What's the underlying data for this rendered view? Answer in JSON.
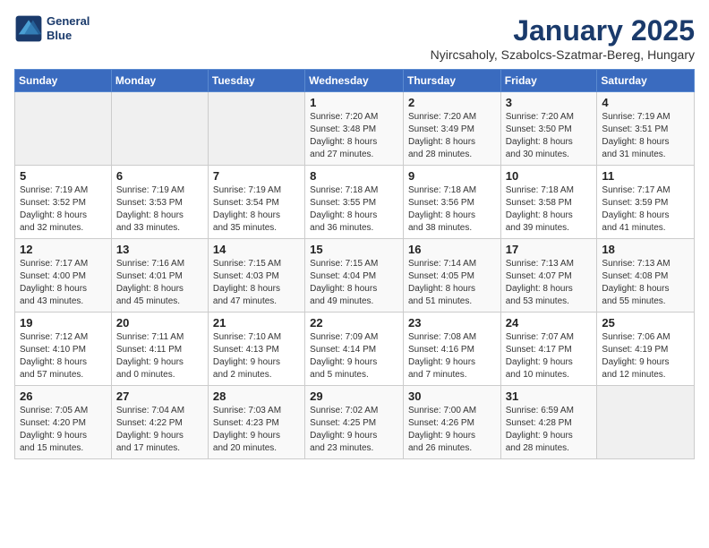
{
  "logo": {
    "line1": "General",
    "line2": "Blue"
  },
  "title": "January 2025",
  "subtitle": "Nyircsaholy, Szabolcs-Szatmar-Bereg, Hungary",
  "days_of_week": [
    "Sunday",
    "Monday",
    "Tuesday",
    "Wednesday",
    "Thursday",
    "Friday",
    "Saturday"
  ],
  "weeks": [
    [
      {
        "day": "",
        "info": ""
      },
      {
        "day": "",
        "info": ""
      },
      {
        "day": "",
        "info": ""
      },
      {
        "day": "1",
        "info": "Sunrise: 7:20 AM\nSunset: 3:48 PM\nDaylight: 8 hours\nand 27 minutes."
      },
      {
        "day": "2",
        "info": "Sunrise: 7:20 AM\nSunset: 3:49 PM\nDaylight: 8 hours\nand 28 minutes."
      },
      {
        "day": "3",
        "info": "Sunrise: 7:20 AM\nSunset: 3:50 PM\nDaylight: 8 hours\nand 30 minutes."
      },
      {
        "day": "4",
        "info": "Sunrise: 7:19 AM\nSunset: 3:51 PM\nDaylight: 8 hours\nand 31 minutes."
      }
    ],
    [
      {
        "day": "5",
        "info": "Sunrise: 7:19 AM\nSunset: 3:52 PM\nDaylight: 8 hours\nand 32 minutes."
      },
      {
        "day": "6",
        "info": "Sunrise: 7:19 AM\nSunset: 3:53 PM\nDaylight: 8 hours\nand 33 minutes."
      },
      {
        "day": "7",
        "info": "Sunrise: 7:19 AM\nSunset: 3:54 PM\nDaylight: 8 hours\nand 35 minutes."
      },
      {
        "day": "8",
        "info": "Sunrise: 7:18 AM\nSunset: 3:55 PM\nDaylight: 8 hours\nand 36 minutes."
      },
      {
        "day": "9",
        "info": "Sunrise: 7:18 AM\nSunset: 3:56 PM\nDaylight: 8 hours\nand 38 minutes."
      },
      {
        "day": "10",
        "info": "Sunrise: 7:18 AM\nSunset: 3:58 PM\nDaylight: 8 hours\nand 39 minutes."
      },
      {
        "day": "11",
        "info": "Sunrise: 7:17 AM\nSunset: 3:59 PM\nDaylight: 8 hours\nand 41 minutes."
      }
    ],
    [
      {
        "day": "12",
        "info": "Sunrise: 7:17 AM\nSunset: 4:00 PM\nDaylight: 8 hours\nand 43 minutes."
      },
      {
        "day": "13",
        "info": "Sunrise: 7:16 AM\nSunset: 4:01 PM\nDaylight: 8 hours\nand 45 minutes."
      },
      {
        "day": "14",
        "info": "Sunrise: 7:15 AM\nSunset: 4:03 PM\nDaylight: 8 hours\nand 47 minutes."
      },
      {
        "day": "15",
        "info": "Sunrise: 7:15 AM\nSunset: 4:04 PM\nDaylight: 8 hours\nand 49 minutes."
      },
      {
        "day": "16",
        "info": "Sunrise: 7:14 AM\nSunset: 4:05 PM\nDaylight: 8 hours\nand 51 minutes."
      },
      {
        "day": "17",
        "info": "Sunrise: 7:13 AM\nSunset: 4:07 PM\nDaylight: 8 hours\nand 53 minutes."
      },
      {
        "day": "18",
        "info": "Sunrise: 7:13 AM\nSunset: 4:08 PM\nDaylight: 8 hours\nand 55 minutes."
      }
    ],
    [
      {
        "day": "19",
        "info": "Sunrise: 7:12 AM\nSunset: 4:10 PM\nDaylight: 8 hours\nand 57 minutes."
      },
      {
        "day": "20",
        "info": "Sunrise: 7:11 AM\nSunset: 4:11 PM\nDaylight: 9 hours\nand 0 minutes."
      },
      {
        "day": "21",
        "info": "Sunrise: 7:10 AM\nSunset: 4:13 PM\nDaylight: 9 hours\nand 2 minutes."
      },
      {
        "day": "22",
        "info": "Sunrise: 7:09 AM\nSunset: 4:14 PM\nDaylight: 9 hours\nand 5 minutes."
      },
      {
        "day": "23",
        "info": "Sunrise: 7:08 AM\nSunset: 4:16 PM\nDaylight: 9 hours\nand 7 minutes."
      },
      {
        "day": "24",
        "info": "Sunrise: 7:07 AM\nSunset: 4:17 PM\nDaylight: 9 hours\nand 10 minutes."
      },
      {
        "day": "25",
        "info": "Sunrise: 7:06 AM\nSunset: 4:19 PM\nDaylight: 9 hours\nand 12 minutes."
      }
    ],
    [
      {
        "day": "26",
        "info": "Sunrise: 7:05 AM\nSunset: 4:20 PM\nDaylight: 9 hours\nand 15 minutes."
      },
      {
        "day": "27",
        "info": "Sunrise: 7:04 AM\nSunset: 4:22 PM\nDaylight: 9 hours\nand 17 minutes."
      },
      {
        "day": "28",
        "info": "Sunrise: 7:03 AM\nSunset: 4:23 PM\nDaylight: 9 hours\nand 20 minutes."
      },
      {
        "day": "29",
        "info": "Sunrise: 7:02 AM\nSunset: 4:25 PM\nDaylight: 9 hours\nand 23 minutes."
      },
      {
        "day": "30",
        "info": "Sunrise: 7:00 AM\nSunset: 4:26 PM\nDaylight: 9 hours\nand 26 minutes."
      },
      {
        "day": "31",
        "info": "Sunrise: 6:59 AM\nSunset: 4:28 PM\nDaylight: 9 hours\nand 28 minutes."
      },
      {
        "day": "",
        "info": ""
      }
    ]
  ]
}
